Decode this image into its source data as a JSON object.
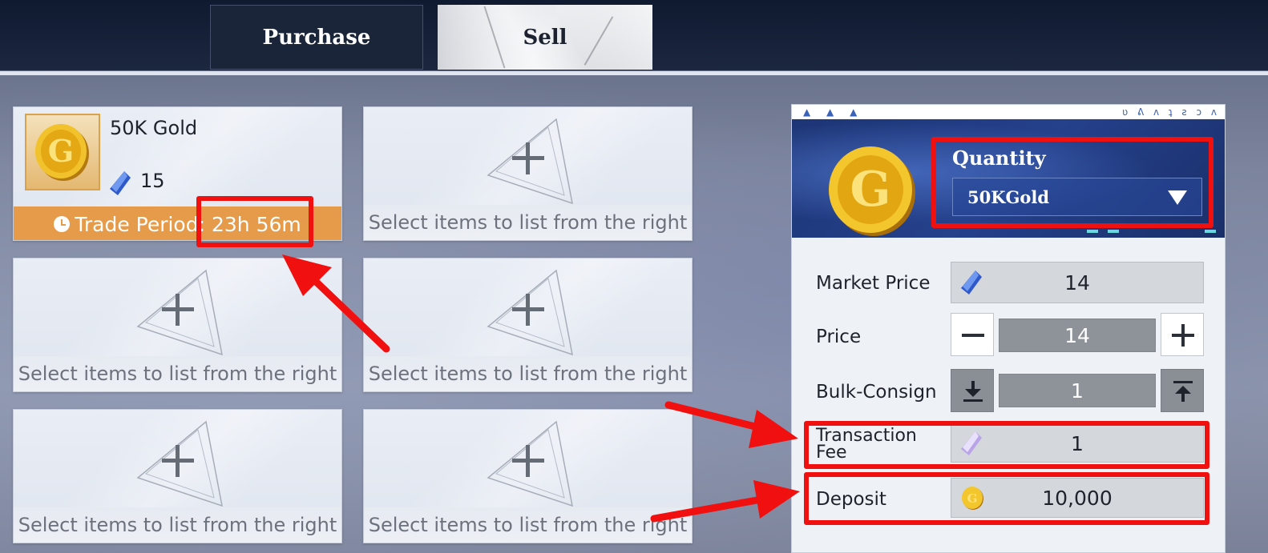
{
  "tabs": {
    "purchase": "Purchase",
    "sell": "Sell"
  },
  "listed_item": {
    "name": "50K Gold",
    "price": "15",
    "trade_period": "Trade Period: 23h 56m",
    "icon": "gold-coin-icon"
  },
  "empty_slot": {
    "hint": "Select items to list from the right"
  },
  "panel": {
    "top_ticker_left": "▲ ▲ ▲",
    "top_ticker_right": "ʋ ᕕ ʌ ʇ ƨ ɔ ʌ",
    "quantity_label": "Quantity",
    "quantity_value": "50KGold",
    "market_price_label": "Market Price",
    "market_price_value": "14",
    "price_label": "Price",
    "price_value": "14",
    "bulk_label": "Bulk-Consign",
    "bulk_value": "1",
    "fee_label_1": "Transaction",
    "fee_label_2": "Fee",
    "fee_value": "1",
    "deposit_label": "Deposit",
    "deposit_value": "10,000"
  },
  "colors": {
    "annotation": "#f01010",
    "trade_bar": "#e69b4a",
    "header_blue": "#25418c"
  }
}
